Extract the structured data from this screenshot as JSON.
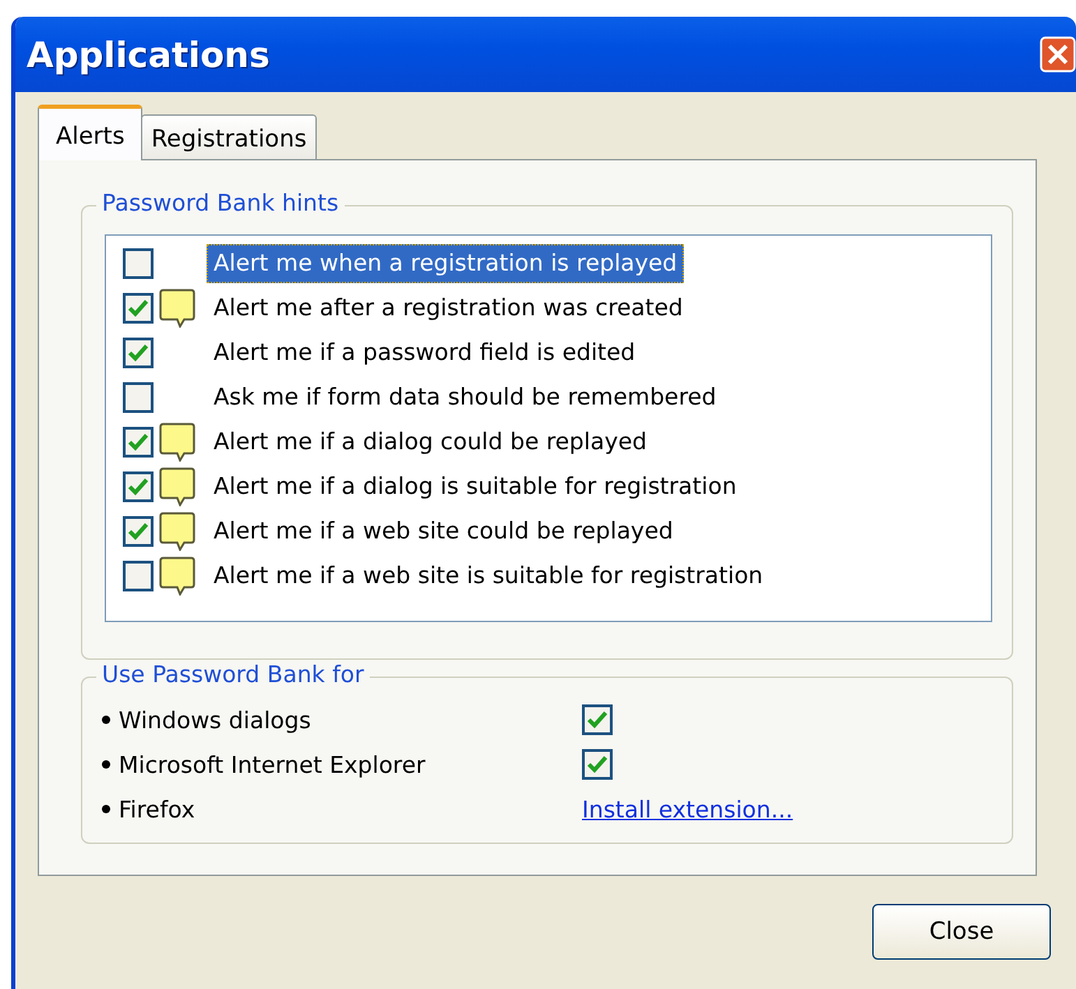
{
  "window": {
    "title": "Applications"
  },
  "tabs": [
    {
      "label": "Alerts",
      "selected": true
    },
    {
      "label": "Registrations",
      "selected": false
    }
  ],
  "hints": {
    "title": "Password Bank hints",
    "items": [
      {
        "label": "Alert me when a registration is replayed",
        "checked": false,
        "note": false,
        "selected": true
      },
      {
        "label": "Alert me after a registration was created",
        "checked": true,
        "note": true,
        "selected": false
      },
      {
        "label": "Alert me if a password field is edited",
        "checked": true,
        "note": false,
        "selected": false
      },
      {
        "label": "Ask me if form data should be remembered",
        "checked": false,
        "note": false,
        "selected": false
      },
      {
        "label": "Alert me if a dialog could be replayed",
        "checked": true,
        "note": true,
        "selected": false
      },
      {
        "label": "Alert me if a dialog is suitable for registration",
        "checked": true,
        "note": true,
        "selected": false
      },
      {
        "label": "Alert me if a web site could be replayed",
        "checked": true,
        "note": true,
        "selected": false
      },
      {
        "label": "Alert me if a web site is suitable for registration",
        "checked": false,
        "note": true,
        "selected": false
      }
    ]
  },
  "use_for": {
    "title": "Use Password Bank for",
    "items": [
      {
        "label": "Windows dialogs",
        "kind": "checkbox",
        "checked": true
      },
      {
        "label": "Microsoft Internet Explorer",
        "kind": "checkbox",
        "checked": true
      },
      {
        "label": "Firefox",
        "kind": "link",
        "link": "Install extension..."
      }
    ]
  },
  "buttons": [
    {
      "label": "Close"
    }
  ]
}
